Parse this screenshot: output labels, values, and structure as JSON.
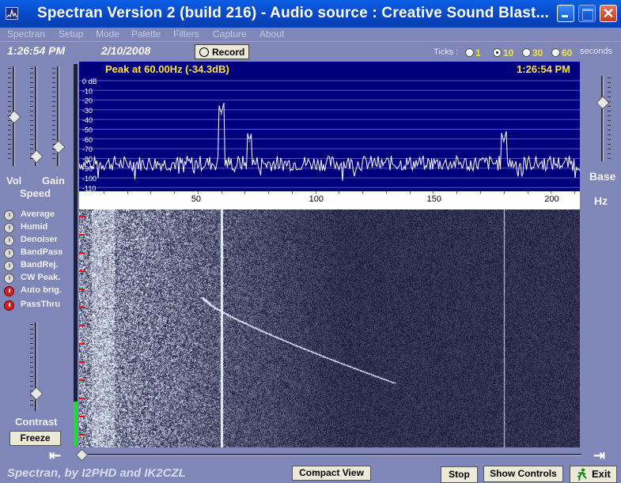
{
  "window": {
    "title": "Spectran Version 2 (build 216) - Audio source  :  Creative Sound Blast..."
  },
  "menu": [
    "Spectran",
    "Setup",
    "Mode",
    "Palette",
    "Filters",
    "Capture",
    "About"
  ],
  "status": {
    "time": "1:26:54 PM",
    "date": "2/10/2008",
    "record_label": "Record"
  },
  "ticks": {
    "label": "Ticks :",
    "options": [
      "1",
      "10",
      "30",
      "60"
    ],
    "selected": "10",
    "unit": "seconds"
  },
  "left_panel": {
    "vol_label": "Vol",
    "gain_label": "Gain",
    "speed_label": "Speed",
    "contrast_label": "Contrast",
    "freeze_label": "Freeze",
    "options": [
      {
        "label": "Average",
        "on": false
      },
      {
        "label": "Humid",
        "on": false
      },
      {
        "label": "Denoiser",
        "on": false
      },
      {
        "label": "BandPass",
        "on": false
      },
      {
        "label": "BandRej.",
        "on": false
      },
      {
        "label": "CW Peak.",
        "on": false
      },
      {
        "label": "Auto brig.",
        "on": true
      },
      {
        "label": "PassThru",
        "on": true
      }
    ]
  },
  "right_panel": {
    "base_label": "Base",
    "hz_label": "Hz"
  },
  "spectrum": {
    "peak_text": "Peak at    60.00Hz (-34.3dB)",
    "time": "1:26:54 PM",
    "db_labels": [
      "0 dB",
      "-10",
      "-20",
      "-30",
      "-40",
      "-50",
      "-60",
      "-70",
      "-80",
      "-90",
      "-100",
      "-110"
    ]
  },
  "chart_data": {
    "type": "line",
    "x_range_hz": [
      0,
      212
    ],
    "y_range_db": [
      -110,
      0
    ],
    "freq_ticks": [
      "50",
      "100",
      "150",
      "200"
    ],
    "noise_floor_db": -85,
    "peaks": [
      {
        "freq_hz": 60,
        "db": -34.3
      },
      {
        "freq_hz": 72,
        "db": -62
      },
      {
        "freq_hz": 180,
        "db": -63
      }
    ]
  },
  "footer": {
    "credit": "Spectran, by I2PHD and IK2CZL",
    "compact_view_label": "Compact View",
    "stop_label": "Stop",
    "show_controls_label": "Show Controls",
    "exit_label": "Exit"
  },
  "colors": {
    "background": "#7f86b8",
    "spectrum_bg": "#00007c",
    "spectrum_text": "#ffe431",
    "waterfall_signal": "#c8d2ff",
    "vu_level": "#16e31e"
  },
  "icons": {
    "app": "spectrum-app-icon",
    "exit": "running-man-icon"
  }
}
